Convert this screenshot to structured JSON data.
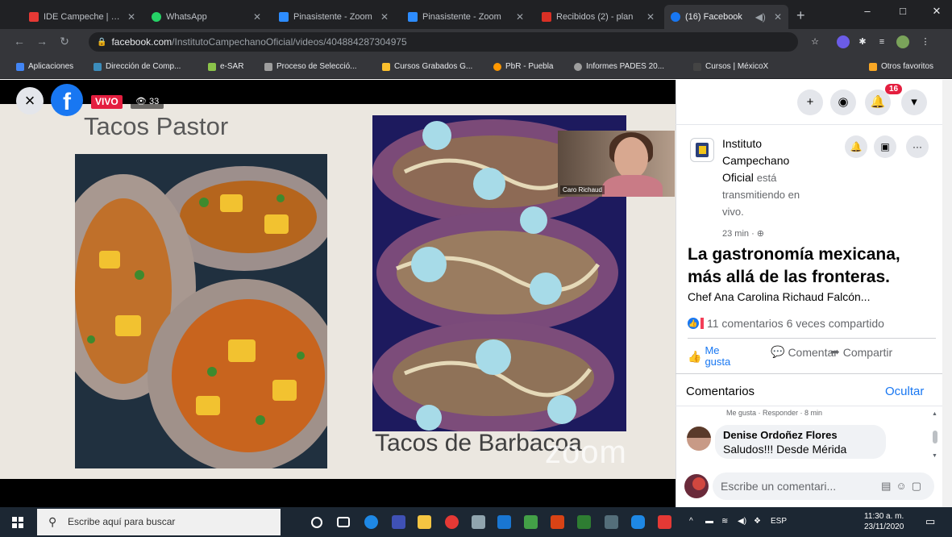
{
  "browser": {
    "tabs": [
      {
        "label": "IDE Campeche | Pro",
        "color": "#e53935",
        "active": false
      },
      {
        "label": "WhatsApp",
        "color": "#25d366",
        "active": false
      },
      {
        "label": "Pinasistente - Zoom",
        "color": "#2d8cff",
        "active": false
      },
      {
        "label": "Pinasistente - Zoom",
        "color": "#2d8cff",
        "active": false
      },
      {
        "label": "Recibidos (2) - plan",
        "color": "#d93025",
        "active": false
      },
      {
        "label": "(16) Facebook",
        "color": "#1877f2",
        "active": true
      }
    ],
    "new_tab": "+",
    "window_controls": [
      "–",
      "□",
      "✕"
    ],
    "url_host": "facebook.com",
    "url_path": "/InstitutoCampechanoOficial/videos/404884287304975"
  },
  "bookmarks": [
    {
      "label": "Aplicaciones",
      "color": "#4285f4"
    },
    {
      "label": "Dirección de Comp...",
      "color": "#3c8dbc"
    },
    {
      "label": "e-SAR",
      "color": "#8bc34a"
    },
    {
      "label": "Proceso de Selecció...",
      "color": "#9e9e9e"
    },
    {
      "label": "Cursos Grabados G...",
      "color": "#fbc02d"
    },
    {
      "label": "PbR - Puebla",
      "color": "#ff9800"
    },
    {
      "label": "Informes PADES 20...",
      "color": "#9e9e9e"
    },
    {
      "label": "Cursos | MéxicoX",
      "color": "#444444"
    },
    {
      "label": "Otros favoritos",
      "color": "#f9a825"
    }
  ],
  "video": {
    "live_label": "VIVO",
    "viewers": "33",
    "slide_title_1": "Tacos Pastor",
    "slide_title_2": "Tacos de Barbacoa",
    "watermark": "zoom",
    "camera_name": "Caro Richaud"
  },
  "panel": {
    "notification_count": "16",
    "page_name_line1": "Instituto",
    "page_name_line2": "Campechano",
    "page_name_line3": "Oficial",
    "status_1": "está",
    "status_2": "transmitiendo en",
    "status_3": "vivo.",
    "time": "23 min · ",
    "title": "La gastronomía mexicana, más allá de las fronteras.",
    "subtitle": "Chef Ana Carolina Richaud Falcón...",
    "stats": "11 comentarios 6 veces compartido",
    "like_line1": "Me",
    "like_line2": "gusta",
    "comment_label": "Comentar",
    "share_label": "Compartir",
    "comments_header": "Comentarios",
    "hide_label": "Ocultar",
    "comment_meta": "Me gusta · Responder · 8 min",
    "comment_author": "Denise Ordoñez Flores",
    "comment_text": "Saludos!!! Desde Mérida",
    "write_placeholder": "Escribe un comentari..."
  },
  "taskbar": {
    "search_placeholder": "Escribe aquí para buscar",
    "lang": "ESP",
    "time": "11:30 a. m.",
    "date": "23/11/2020"
  }
}
